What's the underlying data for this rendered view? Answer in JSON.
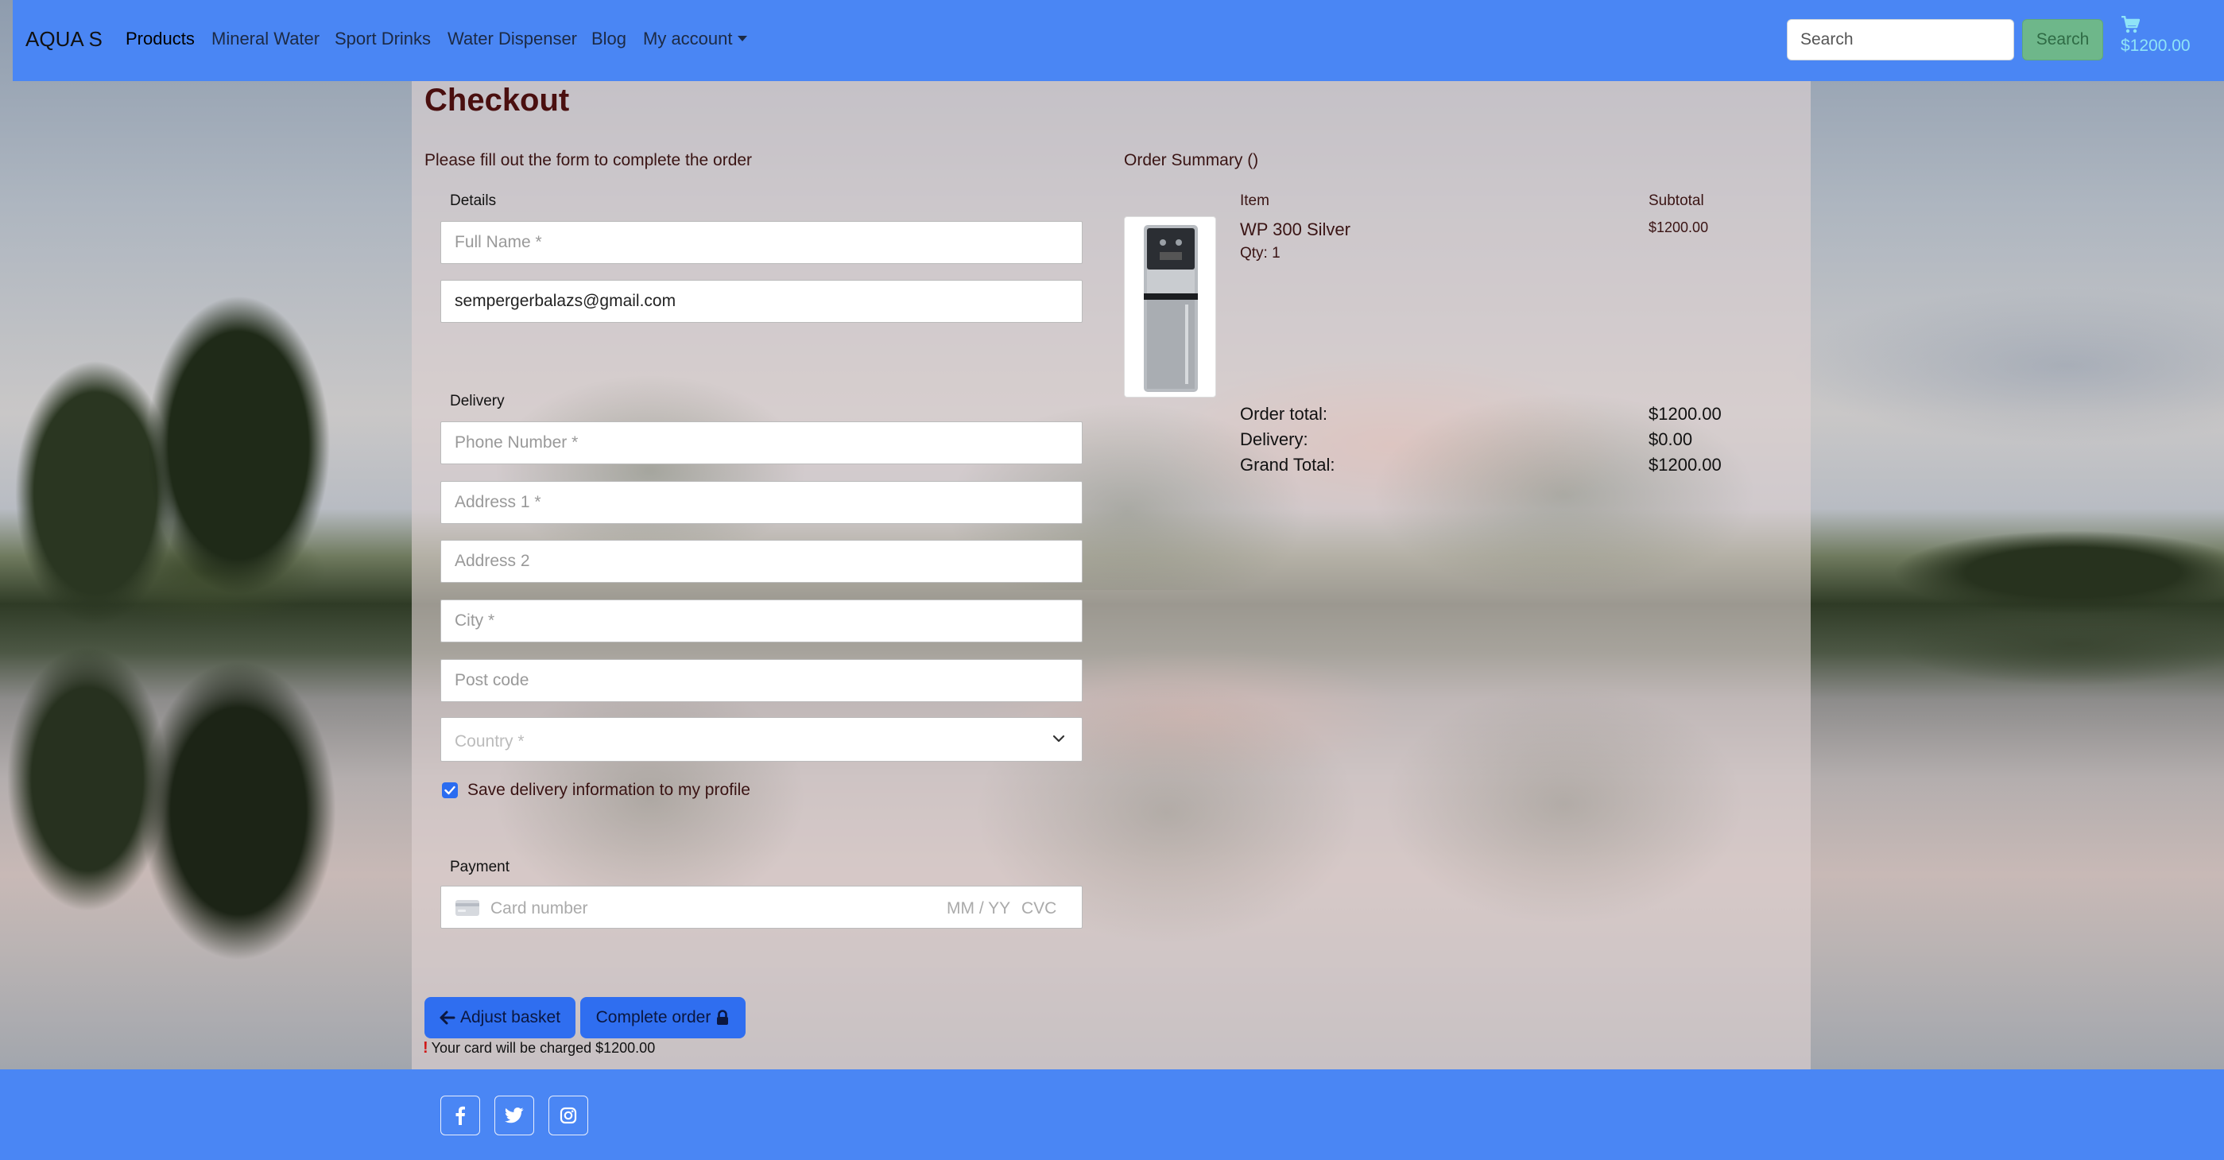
{
  "colors": {
    "navbar_bg": "#4a86f4",
    "primary_button": "#2f6ef0",
    "search_button": "#6eb78a",
    "title_color": "#4a0f0f",
    "cart_color": "#8fe4f7"
  },
  "nav": {
    "brand": "AQUA S",
    "links": [
      "Products",
      "Mineral Water",
      "Sport Drinks",
      "Water Dispenser",
      "Blog",
      "My account"
    ],
    "search_placeholder": "Search",
    "search_button": "Search",
    "cart_icon": "shopping-cart-icon",
    "cart_total": "$1200.00"
  },
  "checkout": {
    "title": "Checkout",
    "intro": "Please fill out the form to complete the order",
    "details_legend": "Details",
    "full_name_placeholder": "Full Name *",
    "email_value": "sempergerbalazs@gmail.com",
    "delivery_legend": "Delivery",
    "phone_placeholder": "Phone Number *",
    "address1_placeholder": "Address 1 *",
    "address2_placeholder": "Address 2",
    "city_placeholder": "City *",
    "postcode_placeholder": "Post code",
    "country_placeholder": "Country *",
    "save_info_label": "Save delivery information to my profile",
    "save_info_checked": true,
    "payment_legend": "Payment",
    "card_placeholder": "Card number",
    "card_expiry_placeholder": "MM / YY",
    "card_cvc_placeholder": "CVC",
    "adjust_basket_label": "Adjust basket",
    "complete_order_label": "Complete order",
    "charge_note": "Your card will be charged $1200.00"
  },
  "summary": {
    "title": "Order Summary ()",
    "col_item": "Item",
    "col_subtotal": "Subtotal",
    "item_name": "WP 300 Silver",
    "item_qty": "Qty: 1",
    "item_subtotal": "$1200.00",
    "order_total_label": "Order total:",
    "order_total_value": "$1200.00",
    "delivery_label": "Delivery:",
    "delivery_value": "$0.00",
    "grand_total_label": "Grand Total:",
    "grand_total_value": "$1200.00"
  },
  "footer": {
    "social_icons": [
      "facebook-icon",
      "twitter-icon",
      "instagram-icon"
    ]
  }
}
